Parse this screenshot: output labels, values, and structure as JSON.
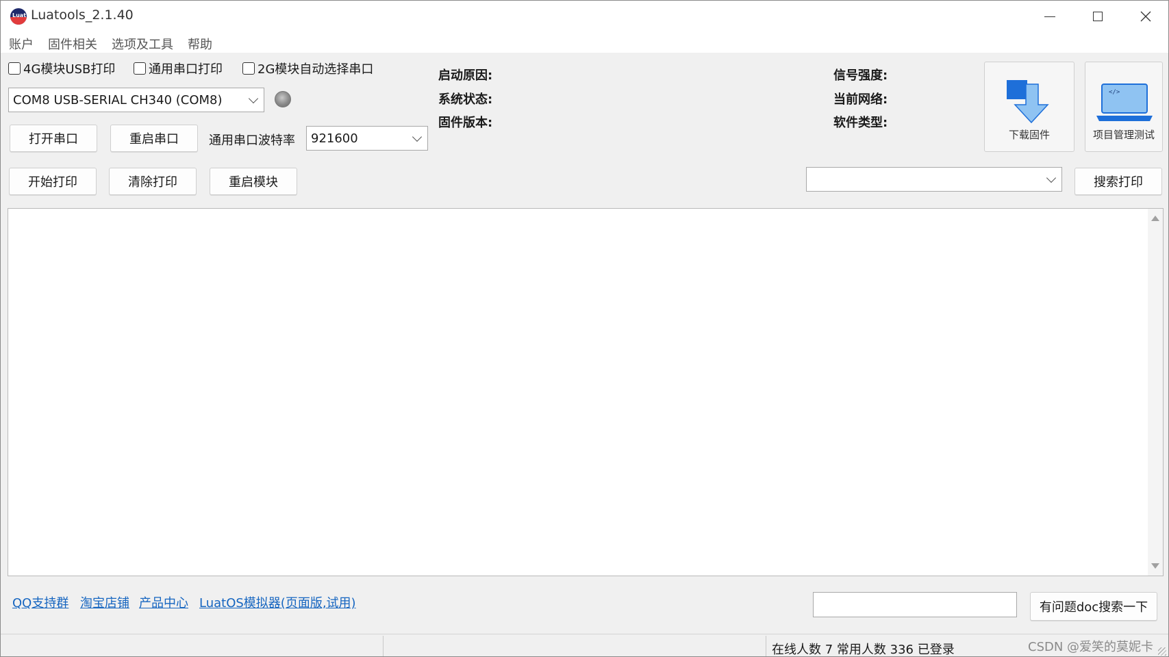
{
  "window": {
    "title": "Luatools_2.1.40"
  },
  "menu": [
    "账户",
    "固件相关",
    "选项及工具",
    "帮助"
  ],
  "checkboxes": [
    {
      "label": "4G模块USB打印",
      "checked": false
    },
    {
      "label": "通用串口打印",
      "checked": false
    },
    {
      "label": "2G模块自动选择串口",
      "checked": false
    }
  ],
  "serial": {
    "port_value": "COM8 USB-SERIAL CH340 (COM8)",
    "open_label": "打开串口",
    "restart_label": "重启串口",
    "baud_label": "通用串口波特率",
    "baud_value": "921600"
  },
  "actions": {
    "start_print": "开始打印",
    "clear_print": "清除打印",
    "restart_module": "重启模块",
    "search_value": "",
    "search_print": "搜索打印"
  },
  "info": {
    "boot_reason": "启动原因:",
    "system_status": "系统状态:",
    "firmware_version": "固件版本:",
    "signal_strength": "信号强度:",
    "current_network": "当前网络:",
    "software_type": "软件类型:"
  },
  "tools": {
    "download_firmware": "下载固件",
    "project_test": "项目管理测试"
  },
  "links": [
    "QQ支持群",
    "淘宝店铺",
    "产品中心",
    "LuatOS模拟器(页面版,试用)"
  ],
  "doc_search": {
    "value": "",
    "button": "有问题doc搜索一下"
  },
  "status": {
    "text": "在线人数 7 常用人数 336 已登录"
  },
  "watermark": "CSDN @爱笑的莫妮卡",
  "icons": [
    "app-logo-icon",
    "minimize-icon",
    "maximize-icon",
    "close-icon",
    "status-led-icon",
    "download-icon",
    "laptop-code-icon"
  ],
  "colors": {
    "accent": "#1e88e5",
    "link": "#1565c0"
  }
}
